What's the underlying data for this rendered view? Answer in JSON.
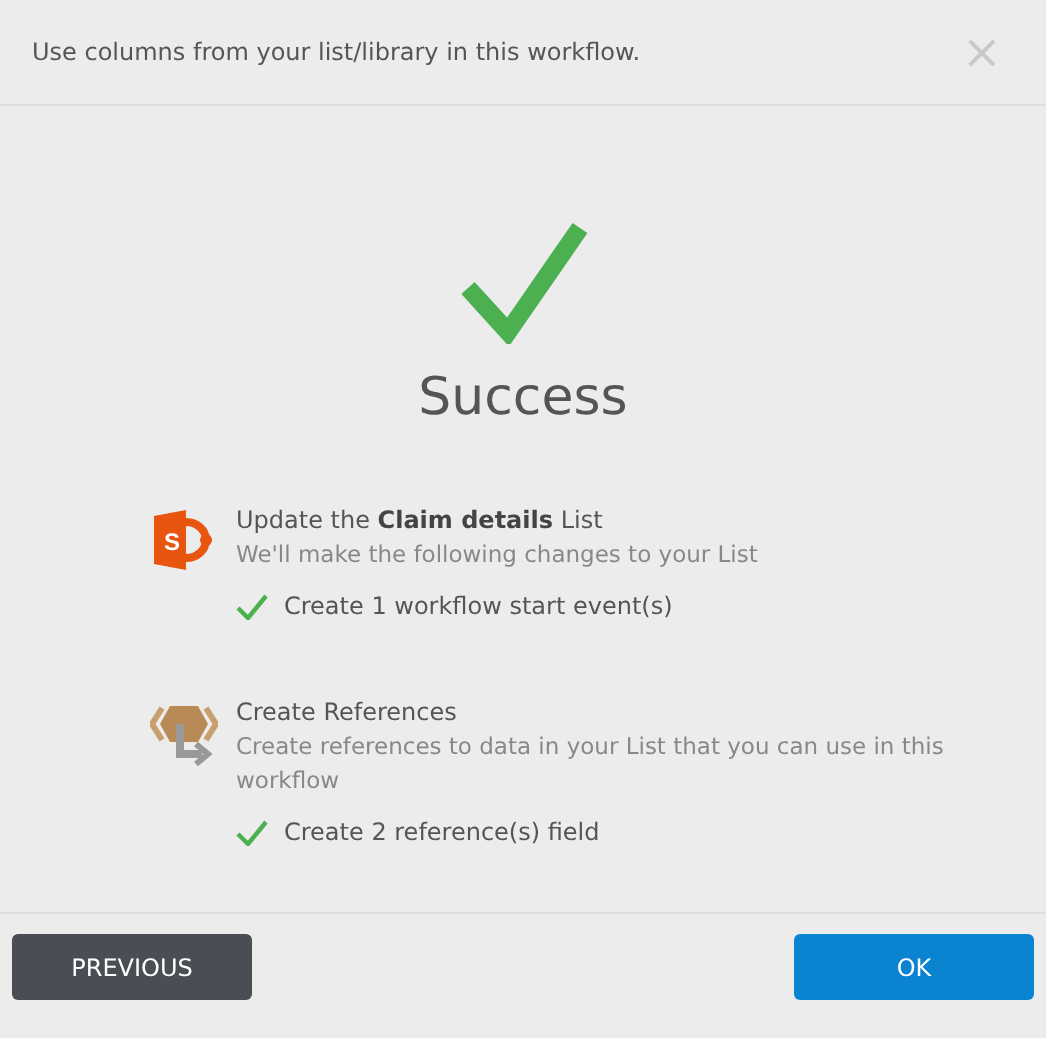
{
  "dialog": {
    "title": "Use columns from your list/library in this workflow.",
    "close": "×"
  },
  "result": {
    "heading": "Success"
  },
  "sections": [
    {
      "kind": "list",
      "icon_letter": "S",
      "title": "Update the **Claim details** List",
      "description": "We'll make the following changes to your List",
      "items": [
        "Create 1 workflow start event(s)"
      ]
    },
    {
      "kind": "references",
      "title": "Create References",
      "description": "Create references to data in your List that you can use in this workflow",
      "items": [
        "Create 2 reference(s) field"
      ]
    }
  ],
  "buttons": {
    "previous": "PREVIOUS",
    "ok": "OK"
  }
}
